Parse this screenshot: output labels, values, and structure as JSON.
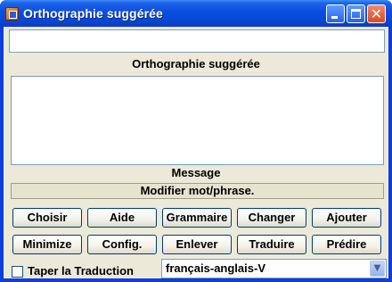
{
  "window": {
    "title": "Orthographie suggérée",
    "icon": "app-icon",
    "controls": {
      "minimize": "minimize-icon",
      "maximize": "maximize-icon",
      "close": "close-icon"
    }
  },
  "suggestion": {
    "value": "",
    "label": "Orthographie suggérée"
  },
  "message": {
    "value": "",
    "label": "Message"
  },
  "status": {
    "text": "Modifier mot/phrase."
  },
  "buttons": {
    "row1": [
      "Choisir",
      "Aide",
      "Grammaire",
      "Changer",
      "Ajouter"
    ],
    "row2": [
      "Minimize",
      "Config.",
      "Enlever",
      "Traduire",
      "Prédire"
    ]
  },
  "translate": {
    "checkbox_label": "Taper la Traduction",
    "checked": false
  },
  "language": {
    "selected": "français-anglais-V"
  },
  "colors": {
    "title_bar": "#0a4ee0",
    "client_bg": "#ece9d8",
    "close_button": "#d84a24"
  }
}
